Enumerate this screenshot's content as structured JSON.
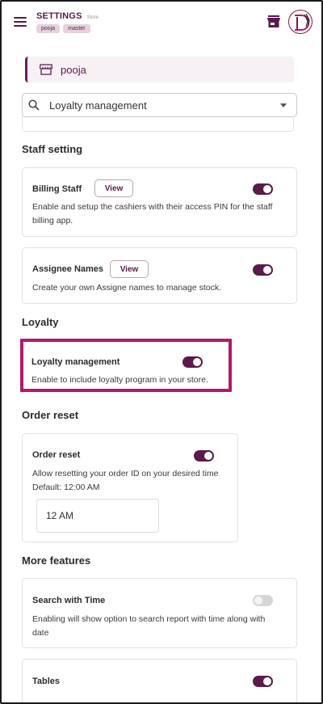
{
  "header": {
    "title": "SETTINGS",
    "subtitle": "Store",
    "chips": [
      "pooja",
      "master"
    ]
  },
  "store": {
    "name": "pooja"
  },
  "search": {
    "value": "Loyalty management"
  },
  "sections": {
    "staff": "Staff setting",
    "loyalty": "Loyalty",
    "order_reset": "Order reset",
    "more": "More features"
  },
  "cards": {
    "billing_staff": {
      "title": "Billing Staff",
      "button": "View",
      "enabled": true,
      "desc1": "Enable and setup the cashiers with their access PIN for the staff",
      "desc2": "billing app."
    },
    "assignee_names": {
      "title": "Assignee Names",
      "button": "View",
      "enabled": true,
      "desc1": "Create your own Assigne names to manage stock."
    },
    "loyalty_management": {
      "title": "Loyalty management",
      "enabled": true,
      "desc1": "Enable to include loyalty program in your store."
    },
    "order_reset": {
      "title": "Order reset",
      "enabled": true,
      "desc1": "Allow resetting your order ID on your desired time",
      "desc2": "Default: 12:00 AM",
      "time_value": "12 AM"
    },
    "search_with_time": {
      "title": "Search with Time",
      "enabled": false,
      "desc1": "Enabling will show option to search report with time along with",
      "desc2": "date"
    },
    "tables": {
      "title": "Tables",
      "enabled": true
    }
  },
  "colors": {
    "accent": "#5a1a4a",
    "highlight": "#b3196b",
    "chip_bg": "#e4d2df"
  }
}
